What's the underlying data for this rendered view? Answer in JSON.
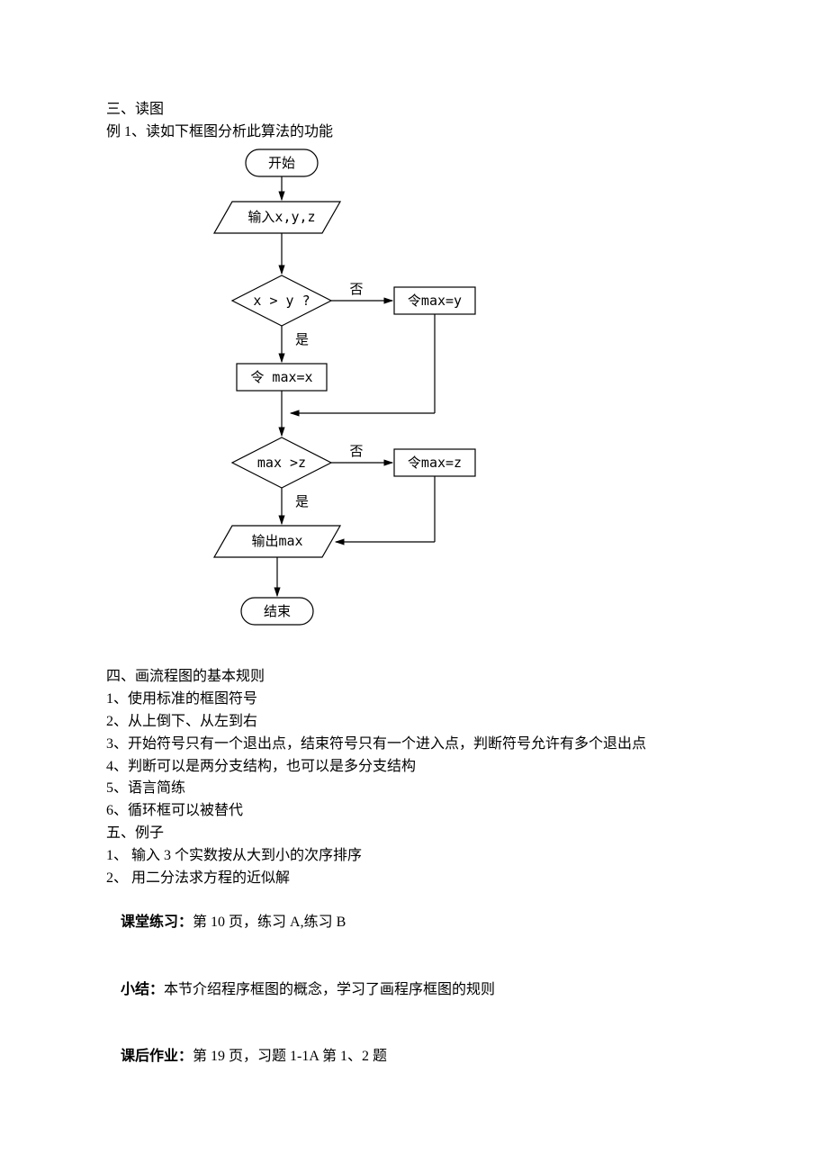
{
  "section3": {
    "title": "三、读图",
    "example": "例 1、读如下框图分析此算法的功能"
  },
  "flow": {
    "start": "开始",
    "input": "输入x,y,z",
    "cond1": "x > y ?",
    "cond1_no": "否",
    "cond1_yes": "是",
    "set_max_y": "令max=y",
    "set_max_x": "令 max=x",
    "cond2": "max >z",
    "cond2_no": "否",
    "cond2_yes": "是",
    "set_max_z": "令max=z",
    "output": "输出max",
    "end": "结束"
  },
  "section4": {
    "title": "四、画流程图的基本规则",
    "r1": "1、使用标准的框图符号",
    "r2": "2、从上倒下、从左到右",
    "r3": "3、开始符号只有一个退出点，结束符号只有一个进入点，判断符号允许有多个退出点",
    "r4": "4、判断可以是两分支结构，也可以是多分支结构",
    "r5": "5、语言简练",
    "r6": "6、循环框可以被替代"
  },
  "section5": {
    "title": "五、例子",
    "e1": "1、 输入 3 个实数按从大到小的次序排序",
    "e2": "2、 用二分法求方程的近似解"
  },
  "classwork": {
    "label": "课堂练习：",
    "text": "第 10 页，练习 A,练习 B"
  },
  "summary": {
    "label": "小结：",
    "text": "本节介绍程序框图的概念，学习了画程序框图的规则"
  },
  "homework": {
    "label": "课后作业：",
    "text": "第 19 页，习题 1-1A 第 1、2 题"
  }
}
